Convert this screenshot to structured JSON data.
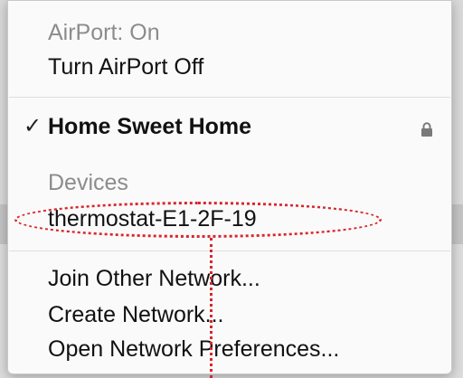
{
  "menu": {
    "status": "AirPort: On",
    "toggle_label": "Turn AirPort Off",
    "current_network": {
      "name": "Home Sweet Home",
      "checked": true,
      "secured": true,
      "check_glyph": "✓",
      "lock_icon": "lock-icon"
    },
    "devices_header": "Devices",
    "devices": [
      {
        "name": "thermostat-E1-2F-19"
      }
    ],
    "actions": [
      {
        "label": "Join Other Network..."
      },
      {
        "label": "Create Network..."
      },
      {
        "label": "Open Network Preferences..."
      }
    ]
  },
  "annotation": {
    "color": "#d9262b",
    "style": "dotted-ellipse-with-pointer"
  }
}
